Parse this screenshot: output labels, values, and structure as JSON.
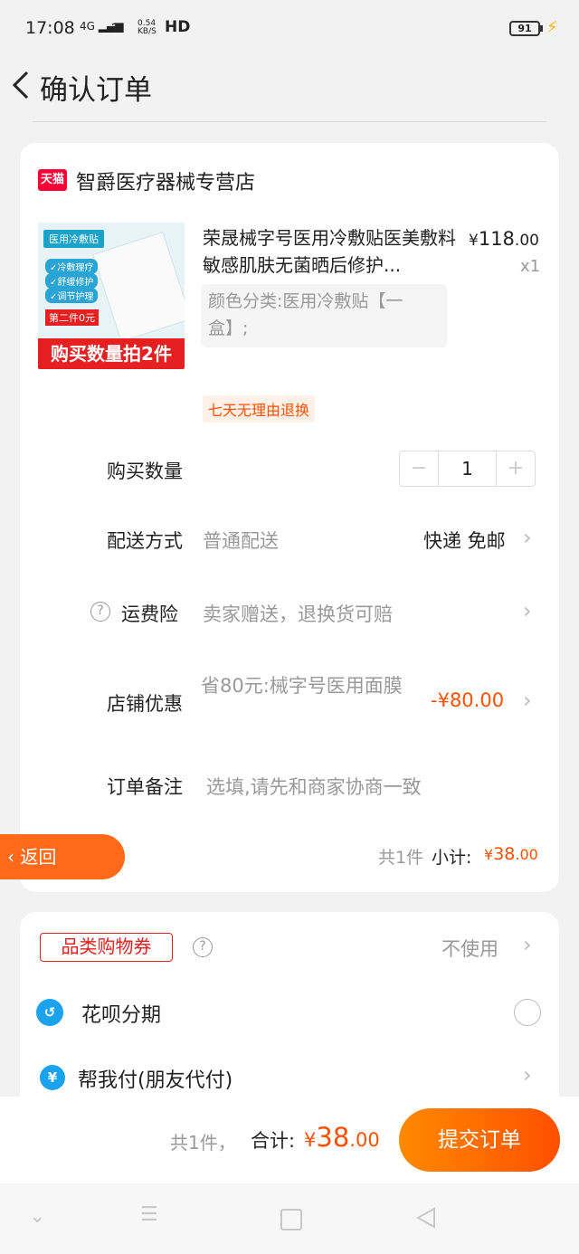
{
  "status": {
    "time": "17:08",
    "net": "4G",
    "speed_top": "0.54",
    "speed_bottom": "KB/S",
    "hd": "HD",
    "battery": "91"
  },
  "header": {
    "title": "确认订单"
  },
  "store": {
    "badge": "天猫",
    "name": "智爵医疗器械专营店"
  },
  "product": {
    "image_tag": "医用冷敷贴",
    "image_lines": [
      "✓冷敷理疗",
      "✓舒缓修护",
      "✓调节护理"
    ],
    "image_promo": "第二件0元",
    "image_banner": "购买数量拍2件",
    "title": "荣晟械字号医用冷敷贴医美敷料敏感肌肤无菌晒后修护...",
    "price_symbol": "¥",
    "price_int": "118",
    "price_dec": ".00",
    "qty": "x1",
    "spec": "颜色分类:医用冷敷贴【一盒】;",
    "return_tag": "七天无理由退换"
  },
  "rows": {
    "quantity_label": "购买数量",
    "quantity_value": "1",
    "shipping_label": "配送方式",
    "shipping_value": "普通配送",
    "shipping_right": "快递 免邮",
    "insurance_label": "运费险",
    "insurance_value": "卖家赠送，退换货可赔",
    "discount_label": "店铺优惠",
    "discount_value": "省80元:械字号医用面膜",
    "discount_amount": "-¥80.00",
    "note_label": "订单备注",
    "note_placeholder": "选填,请先和商家协商一致"
  },
  "subtotal": {
    "count": "共1件",
    "label": "小计:",
    "symbol": "¥",
    "int": "38",
    "dec": ".00"
  },
  "return_button": "返回",
  "payment": {
    "coupon_label": "品类购物券",
    "coupon_value": "不使用",
    "huabei_label": "花呗分期",
    "friend_pay_label": "帮我付(朋友代付)"
  },
  "bottom": {
    "count": "共1件，",
    "label": "合计:",
    "symbol": "¥",
    "int": "38",
    "dec": ".00",
    "submit": "提交订单"
  },
  "colors": {
    "accent": "#ff5000",
    "tmall": "#ff0036",
    "submit_start": "#ff8a00",
    "submit_end": "#ff4f00"
  },
  "icons": [
    "back-arrow-icon",
    "help-icon",
    "chevron-right-icon",
    "huabei-icon",
    "friend-pay-icon",
    "nav-down-icon",
    "nav-menu-icon",
    "nav-home-icon",
    "nav-back-icon"
  ]
}
